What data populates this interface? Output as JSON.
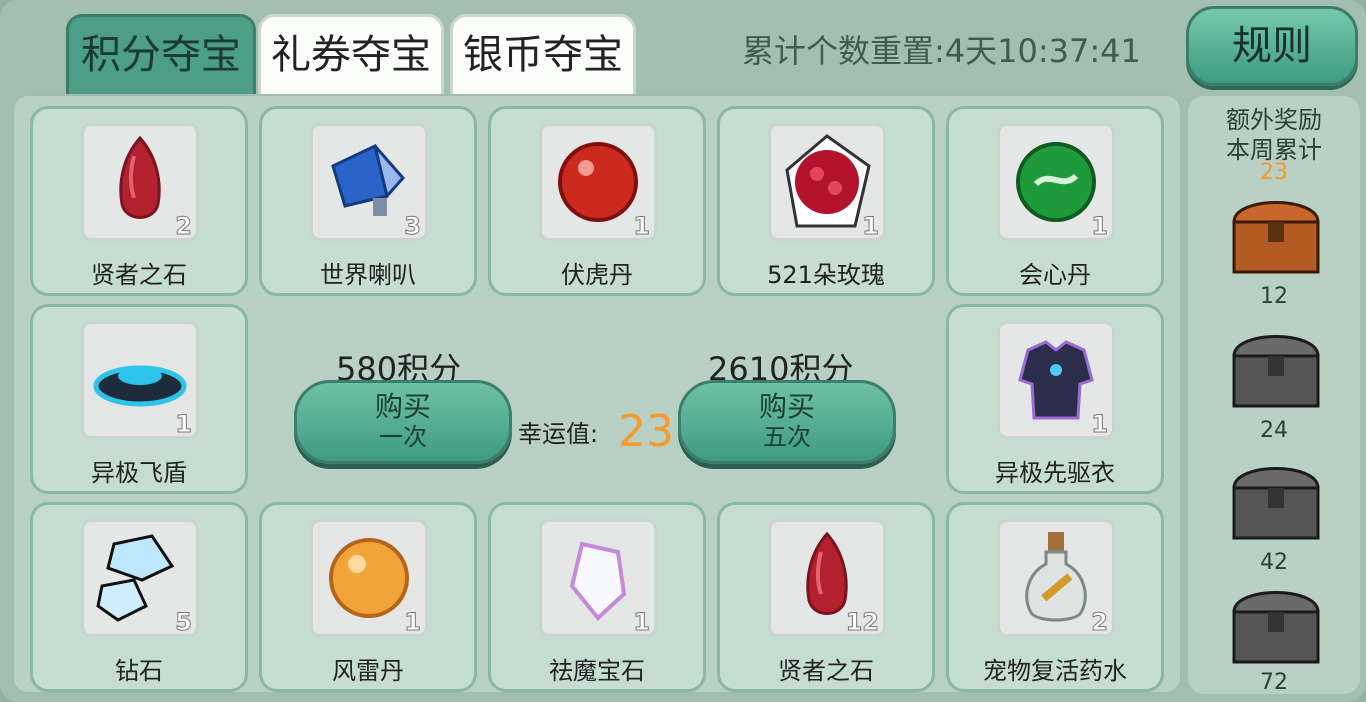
{
  "tabs": [
    {
      "label": "积分夺宝",
      "active": true
    },
    {
      "label": "礼券夺宝",
      "active": false
    },
    {
      "label": "银币夺宝",
      "active": false
    }
  ],
  "reset_timer": "累计个数重置:4天10:37:41",
  "rules_label": "规则",
  "items": [
    {
      "name": "贤者之石",
      "qty": "2",
      "icon": "red-gem-icon"
    },
    {
      "name": "世界喇叭",
      "qty": "3",
      "icon": "megaphone-icon"
    },
    {
      "name": "伏虎丹",
      "qty": "1",
      "icon": "red-pill-icon"
    },
    {
      "name": "521朵玫瑰",
      "qty": "1",
      "icon": "rose-bouquet-icon"
    },
    {
      "name": "会心丹",
      "qty": "1",
      "icon": "green-orb-icon"
    },
    {
      "name": "异极飞盾",
      "qty": "1",
      "icon": "flying-disc-icon"
    },
    {
      "name": "异极先驱衣",
      "qty": "1",
      "icon": "armor-icon"
    },
    {
      "name": "钻石",
      "qty": "5",
      "icon": "diamond-icon"
    },
    {
      "name": "风雷丹",
      "qty": "1",
      "icon": "orange-orb-icon"
    },
    {
      "name": "祛魔宝石",
      "qty": "1",
      "icon": "white-crystal-icon"
    },
    {
      "name": "贤者之石",
      "qty": "12",
      "icon": "red-gem-icon"
    },
    {
      "name": "宠物复活药水",
      "qty": "2",
      "icon": "potion-icon"
    }
  ],
  "luck": {
    "label": "幸运值:",
    "value": "23"
  },
  "buy_once": {
    "cost": "580积分",
    "line1": "购买",
    "line2": "一次"
  },
  "buy_five": {
    "cost": "2610积分",
    "line1": "购买",
    "line2": "五次"
  },
  "extra_rewards": {
    "title1": "额外奖励",
    "title2": "本周累计",
    "count": "23",
    "chests": [
      {
        "threshold": "12",
        "color": "#c8672b"
      },
      {
        "threshold": "24",
        "color": "#5b5b5b"
      },
      {
        "threshold": "42",
        "color": "#5b5b5b"
      },
      {
        "threshold": "72",
        "color": "#5b5b5b"
      }
    ]
  }
}
